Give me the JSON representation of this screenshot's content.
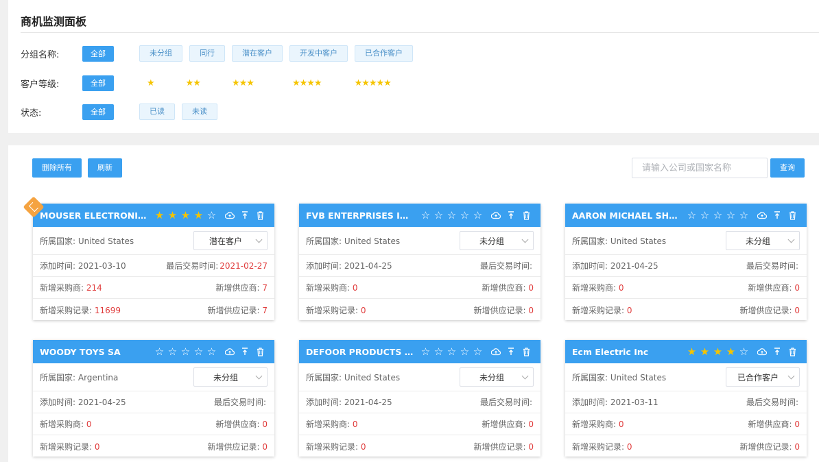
{
  "header": {
    "title": "商机监测面板"
  },
  "filters": {
    "group": {
      "label": "分组名称:",
      "all": "全部",
      "options": [
        "未分组",
        "同行",
        "潜在客户",
        "开发中客户",
        "已合作客户"
      ]
    },
    "level": {
      "label": "客户等级:",
      "all": "全部",
      "options": [
        "★",
        "★★",
        "★★★",
        "★★★★",
        "★★★★★"
      ]
    },
    "status": {
      "label": "状态:",
      "all": "全部",
      "options": [
        "已读",
        "未读"
      ]
    }
  },
  "toolbar": {
    "delete_all": "删除所有",
    "refresh": "刷新",
    "search_placeholder": "请输入公司或国家名称",
    "search_button": "查询"
  },
  "labels": {
    "country": "所属国家: ",
    "added": "添加时间: ",
    "last_trade": "最后交易时间:",
    "new_buyers": "新增采购商: ",
    "new_suppliers": "新增供应商: ",
    "buy_records": "新增采购记录: ",
    "supply_records": "新增供应记录: "
  },
  "cards": [
    {
      "name": "MOUSER ELECTRONICS ...",
      "stars": 4,
      "country": "United States",
      "group": "潜在客户",
      "added": "2021-03-10",
      "last_trade": "2021-02-27",
      "new_buyers": "214",
      "new_suppliers": "7",
      "buy_records": "11699",
      "supply_records": "7"
    },
    {
      "name": "FVB ENTERPRISES INC T...",
      "stars": 0,
      "country": "United States",
      "group": "未分组",
      "added": "2021-04-25",
      "last_trade": "",
      "new_buyers": "0",
      "new_suppliers": "0",
      "buy_records": "0",
      "supply_records": "0"
    },
    {
      "name": "AARON MICHAEL SHAFF...",
      "stars": 0,
      "country": "United States",
      "group": "未分组",
      "added": "2021-04-25",
      "last_trade": "",
      "new_buyers": "0",
      "new_suppliers": "0",
      "buy_records": "0",
      "supply_records": "0"
    },
    {
      "name": "WOODY TOYS SA",
      "stars": 0,
      "country": "Argentina",
      "group": "未分组",
      "added": "2021-04-25",
      "last_trade": "",
      "new_buyers": "0",
      "new_suppliers": "0",
      "buy_records": "0",
      "supply_records": "0"
    },
    {
      "name": "DEFOOR PRODUCTS LLC",
      "stars": 0,
      "country": "United States",
      "group": "未分组",
      "added": "2021-04-25",
      "last_trade": "",
      "new_buyers": "0",
      "new_suppliers": "0",
      "buy_records": "0",
      "supply_records": "0"
    },
    {
      "name": "Ecm Electric Inc",
      "stars": 4,
      "country": "United States",
      "group": "已合作客户",
      "added": "2021-03-11",
      "last_trade": "",
      "new_buyers": "0",
      "new_suppliers": "0",
      "buy_records": "0",
      "supply_records": "0"
    }
  ],
  "colors": {
    "accent": "#3aa0f0",
    "star": "#f5c400",
    "value_red": "#e03c3c",
    "badge": "#f5a340"
  }
}
